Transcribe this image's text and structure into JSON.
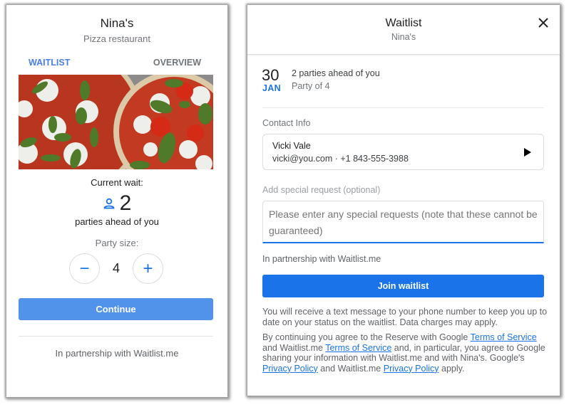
{
  "left_panel": {
    "title": "Nina's",
    "subtitle": "Pizza restaurant",
    "tabs": [
      {
        "label": "WAITLIST",
        "active": true
      },
      {
        "label": "OVERVIEW",
        "active": false
      }
    ],
    "photo_alt": "Margherita pizzas with mozzarella, basil and cherry tomatoes",
    "current_wait_label": "Current wait:",
    "parties_count": "2",
    "parties_label": "parties ahead of you",
    "party_size_label": "Party size:",
    "party_size_value": "4",
    "decrement_symbol": "−",
    "increment_symbol": "+",
    "continue_label": "Continue",
    "partnership": "In partnership with Waitlist.me"
  },
  "right_panel": {
    "title": "Waitlist",
    "subtitle": "Nina's",
    "close_icon": "close-icon",
    "date_day": "30",
    "date_month": "JAN",
    "parties_ahead": "2 parties ahead of you",
    "party_of": "Party of 4",
    "contact_label": "Contact Info",
    "contact": {
      "name": "Vicki Vale",
      "details": "vicki@you.com · +1 843-555-3988"
    },
    "special_request_label": "Add special request (optional)",
    "special_request_placeholder": "Please enter any special requests (note that these cannot be guaranteed)",
    "partnership": "In partnership with Waitlist.me",
    "join_label": "Join waitlist",
    "info_text": "You will receive a text message to your phone number to keep you up to date on your status on the waitlist. Data charges may apply.",
    "legal": {
      "t1": "By continuing you agree to the Reserve with Google ",
      "link1": "Terms of Service",
      "t2": " and Waitlist.me ",
      "link2": "Terms of Service",
      "t3": " and, in particular, you agree to Google sharing your information with Waitlist.me and with Nina's. Google's ",
      "link3": "Privacy Policy",
      "t4": " and Waitlist.me ",
      "link4": "Privacy Policy",
      "t5": " apply."
    }
  },
  "colors": {
    "accent": "#1a73e8",
    "continue_button": "#5192ea",
    "tab_active": "#4a7ee8"
  }
}
